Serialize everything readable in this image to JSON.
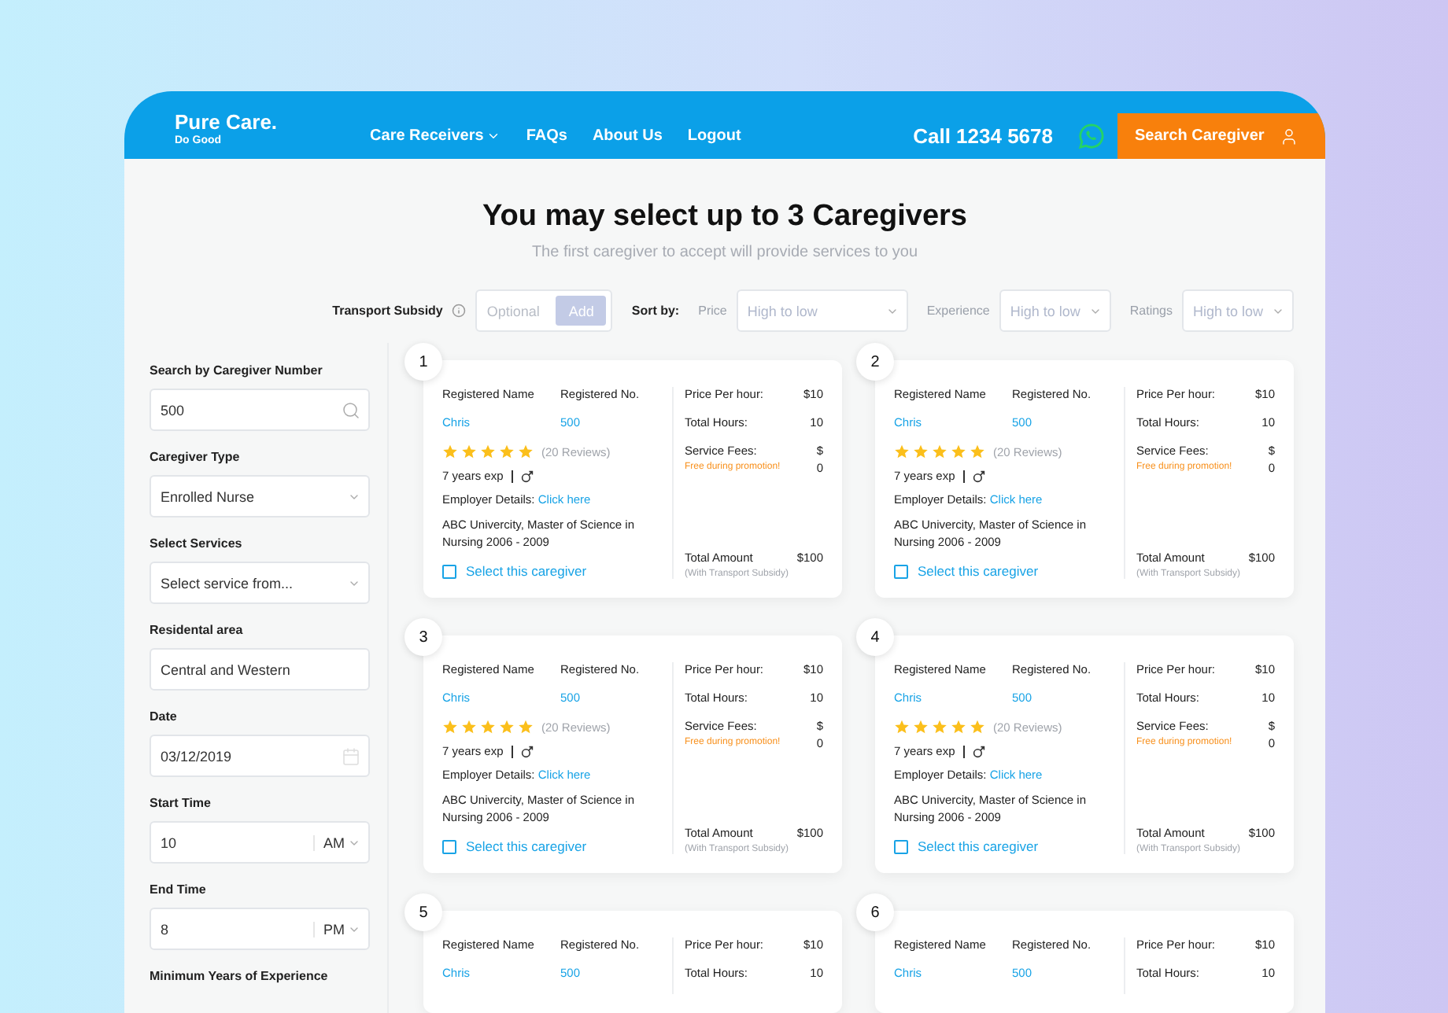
{
  "header": {
    "logo": {
      "name": "Pure Care.",
      "tagline": "Do Good"
    },
    "nav": [
      {
        "label": "Care Receivers",
        "dropdown": true
      },
      {
        "label": "FAQs",
        "dropdown": false
      },
      {
        "label": "About Us",
        "dropdown": false
      },
      {
        "label": "Logout",
        "dropdown": false
      }
    ],
    "phone": "Call 1234 5678",
    "search_button": "Search Caregiver"
  },
  "heading": {
    "title": "You may select up to 3 Caregivers",
    "subtitle": "The first caregiver to accept will provide services to you"
  },
  "transport_subsidy": {
    "label": "Transport Subsidy",
    "placeholder": "Optional",
    "button": "Add"
  },
  "sort": {
    "label": "Sort by:",
    "options": [
      {
        "label": "Price",
        "value": "High to low"
      },
      {
        "label": "Experience",
        "value": "High to low"
      },
      {
        "label": "Ratings",
        "value": "High to low"
      }
    ]
  },
  "filters": [
    {
      "kind": "search",
      "label": "Search by Caregiver Number",
      "value": "500"
    },
    {
      "kind": "select",
      "label": "Caregiver Type",
      "value": "Enrolled Nurse"
    },
    {
      "kind": "select",
      "label": "Select Services",
      "value": "Select service from..."
    },
    {
      "kind": "text",
      "label": "Residental area",
      "value": "Central and Western"
    },
    {
      "kind": "date",
      "label": "Date",
      "value": "03/12/2019"
    },
    {
      "kind": "time",
      "label": "Start Time",
      "value": "10",
      "period": "AM"
    },
    {
      "kind": "time",
      "label": "End Time",
      "value": "8",
      "period": "PM"
    },
    {
      "kind": "label",
      "label": "Minimum Years of Experience"
    }
  ],
  "cards": [
    {
      "number": "1",
      "name_label": "Registered Name",
      "no_label": "Registered No.",
      "name": "Chris",
      "reg_no": "500",
      "stars": 5,
      "reviews": "(20 Reviews)",
      "experience": "7 years exp",
      "employer_label": "Employer Details:",
      "employer_link": "Click here",
      "education": "ABC Univercity, Master of Science in Nursing 2006 - 2009",
      "select_label": "Select this caregiver",
      "checked": false,
      "price_label": "Price Per hour:",
      "price": "$10",
      "hours_label": "Total Hours:",
      "hours": "10",
      "fees_label": "Service Fees:",
      "fees_currency": "$",
      "fees": "0",
      "promo": "Free during promotion!",
      "total_label": "Total Amount",
      "total": "$100",
      "total_note": "(With Transport Subsidy)"
    },
    {
      "number": "2",
      "name_label": "Registered Name",
      "no_label": "Registered No.",
      "name": "Chris",
      "reg_no": "500",
      "stars": 5,
      "reviews": "(20 Reviews)",
      "experience": "7 years exp",
      "employer_label": "Employer Details:",
      "employer_link": "Click here",
      "education": "ABC Univercity, Master of Science in Nursing 2006 - 2009",
      "select_label": "Select this caregiver",
      "checked": false,
      "price_label": "Price Per hour:",
      "price": "$10",
      "hours_label": "Total Hours:",
      "hours": "10",
      "fees_label": "Service Fees:",
      "fees_currency": "$",
      "fees": "0",
      "promo": "Free during promotion!",
      "total_label": "Total Amount",
      "total": "$100",
      "total_note": "(With Transport Subsidy)"
    },
    {
      "number": "3",
      "name_label": "Registered Name",
      "no_label": "Registered No.",
      "name": "Chris",
      "reg_no": "500",
      "stars": 5,
      "reviews": "(20 Reviews)",
      "experience": "7 years exp",
      "employer_label": "Employer Details:",
      "employer_link": "Click here",
      "education": "ABC Univercity, Master of Science in Nursing 2006 - 2009",
      "select_label": "Select this caregiver",
      "checked": false,
      "price_label": "Price Per hour:",
      "price": "$10",
      "hours_label": "Total Hours:",
      "hours": "10",
      "fees_label": "Service Fees:",
      "fees_currency": "$",
      "fees": "0",
      "promo": "Free during promotion!",
      "total_label": "Total Amount",
      "total": "$100",
      "total_note": "(With Transport Subsidy)"
    },
    {
      "number": "4",
      "name_label": "Registered Name",
      "no_label": "Registered No.",
      "name": "Chris",
      "reg_no": "500",
      "stars": 5,
      "reviews": "(20 Reviews)",
      "experience": "7 years exp",
      "employer_label": "Employer Details:",
      "employer_link": "Click here",
      "education": "ABC Univercity, Master of Science in Nursing 2006 - 2009",
      "select_label": "Select this caregiver",
      "checked": false,
      "price_label": "Price Per hour:",
      "price": "$10",
      "hours_label": "Total Hours:",
      "hours": "10",
      "fees_label": "Service Fees:",
      "fees_currency": "$",
      "fees": "0",
      "promo": "Free during promotion!",
      "total_label": "Total Amount",
      "total": "$100",
      "total_note": "(With Transport Subsidy)"
    },
    {
      "number": "5",
      "name_label": "Registered Name",
      "no_label": "Registered No.",
      "name": "Chris",
      "reg_no": "500",
      "price_label": "Price Per hour:",
      "price": "$10",
      "hours_label": "Total Hours:",
      "hours": "10"
    },
    {
      "number": "6",
      "name_label": "Registered Name",
      "no_label": "Registered No.",
      "name": "Chris",
      "reg_no": "500",
      "price_label": "Price Per hour:",
      "price": "$10",
      "hours_label": "Total Hours:",
      "hours": "10"
    }
  ]
}
